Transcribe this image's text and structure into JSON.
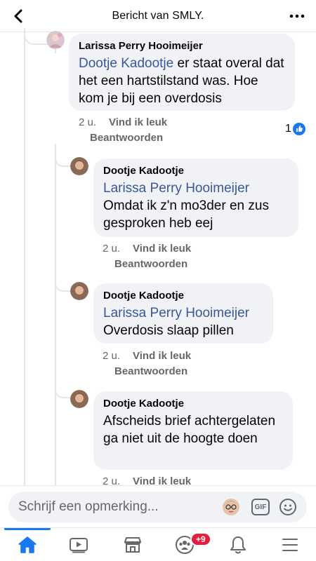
{
  "header": {
    "title": "Bericht van SMLY.",
    "back_icon": "chevron-left-icon",
    "more_icon": "more-horizontal-icon"
  },
  "comments": [
    {
      "author": "Larissa Perry Hooimeijer",
      "mention": "Dootje Kadootje",
      "text": " er staat overal dat het een hartstilstand was. Hoe kom je bij een overdosis",
      "time": "2 u.",
      "like": "Vind ik leuk",
      "reply": "Beantwoorden",
      "reaction_count": "1",
      "reaction_icon": "like-icon"
    },
    {
      "author": "Dootje Kadootje",
      "mention": "Larissa Perry Hooimeijer",
      "text": "Omdat ik z'n mo3der en zus gesproken heb eej",
      "time": "2 u.",
      "like": "Vind ik leuk",
      "reply": "Beantwoorden"
    },
    {
      "author": "Dootje Kadootje",
      "mention": "Larissa Perry Hooimeijer",
      "text": "Overdosis slaap pillen",
      "time": "2 u.",
      "like": "Vind ik leuk",
      "reply": "Beantwoorden"
    },
    {
      "author": "Dootje Kadootje",
      "mention": "",
      "text": "Afscheids brief achtergelaten ga niet uit de hoogte doen",
      "time": "2 u.",
      "like": "Vind ik leuk"
    }
  ],
  "composer": {
    "placeholder": "Schrijf een opmerking...",
    "avatar_icon": "avatar-sticker-icon",
    "gif_label": "GIF",
    "emoji_icon": "smiley-icon"
  },
  "tabbar": {
    "tabs": [
      "home-icon",
      "video-icon",
      "marketplace-icon",
      "groups-icon",
      "bell-icon",
      "menu-icon"
    ],
    "groups_badge": "+9",
    "accent": "#1877f2"
  },
  "colors": {
    "mention": "#385898",
    "bubble": "#f0f2f5",
    "meta": "#65676b",
    "badge": "#e41e3f"
  }
}
